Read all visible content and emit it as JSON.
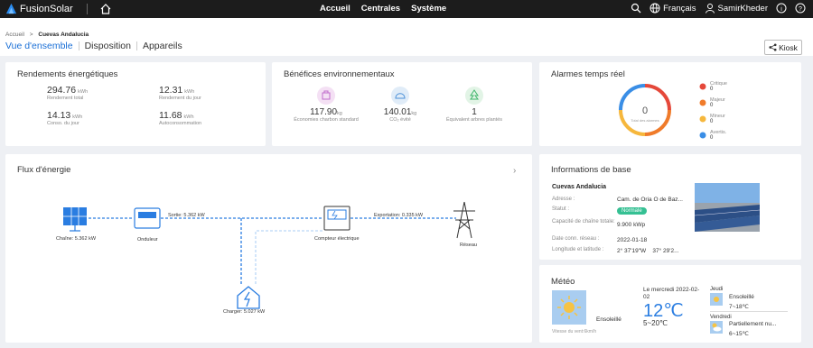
{
  "topbar": {
    "brand": "FusionSolar",
    "nav": [
      "Accueil",
      "Centrales",
      "Système"
    ],
    "language": "Français",
    "user": "SamirKheder",
    "info_icon": "i",
    "help_icon": "?"
  },
  "breadcrumb": {
    "root": "Accueil",
    "current": "Cuevas Andalucia",
    "separator": ">"
  },
  "tabs": [
    "Vue d'ensemble",
    "Disposition",
    "Appareils"
  ],
  "kiosk_label": "Kiosk",
  "yields": {
    "title": "Rendements énergétiques",
    "items": [
      {
        "value": "294.76",
        "unit": "kWh",
        "label": "Rendement total"
      },
      {
        "value": "12.31",
        "unit": "kWh",
        "label": "Rendement du jour"
      },
      {
        "value": "14.13",
        "unit": "kWh",
        "label": "Conso. du jour"
      },
      {
        "value": "11.68",
        "unit": "kWh",
        "label": "Autoconsommation"
      }
    ]
  },
  "env": {
    "title": "Bénéfices environnementaux",
    "items": [
      {
        "value": "117.90",
        "unit": "kg",
        "label": "Économies charbon standard",
        "color": "#f4e0f4"
      },
      {
        "value": "140.01",
        "unit": "kg",
        "label": "CO₂ évité",
        "color": "#e0ecf8"
      },
      {
        "value": "1",
        "unit": "",
        "label": "Équivalent arbres plantés",
        "color": "#e2f4e6"
      }
    ]
  },
  "alarms": {
    "title": "Alarmes temps réel",
    "total": "0",
    "total_label": "Total des alarmes",
    "items": [
      {
        "name": "Critique",
        "count": "0",
        "color": "#e5483a"
      },
      {
        "name": "Majeur",
        "count": "0",
        "color": "#f07b2a"
      },
      {
        "name": "Mineur",
        "count": "0",
        "color": "#f6b73c"
      },
      {
        "name": "Avertis.",
        "count": "0",
        "color": "#3a8ee6"
      }
    ]
  },
  "flow": {
    "title": "Flux d'énergie",
    "chaine": "Chaîne: 5.362 kW",
    "onduleur": "Onduleur",
    "sortie": "Sortie: 5.362 kW",
    "compteur": "Compteur électrique",
    "export": "Exportation: 0.335 kW",
    "reseau": "Réseau",
    "charger": "Charger: 5.027 kW"
  },
  "base": {
    "title": "Informations de base",
    "site": "Cuevas Andalucia",
    "rows": [
      {
        "label": "Adresse :",
        "value": "Cam. de Oria O de Baz..."
      },
      {
        "label": "Statut :",
        "value": "Normale"
      },
      {
        "label": "Capacité de chaîne totale:",
        "value": "9.900 kWp"
      },
      {
        "label": "Date conn. réseau :",
        "value": "2022-01-18"
      },
      {
        "label": "Longitude et latitude :",
        "value": "2° 37'19\"W    37° 29'2..."
      }
    ]
  },
  "weather": {
    "title": "Météo",
    "cond": "Ensoleillé",
    "wind": "Vitesse du vent:6km/h",
    "date": "Le mercredi  2022-02-02",
    "temp": "12℃",
    "range": "5~20℃",
    "forecast": [
      {
        "day": "Jeudi",
        "cond": "Ensoleillé",
        "range": "7~18℃"
      },
      {
        "day": "Vendredi",
        "cond": "Partiellement nu...",
        "range": "6~15℃"
      }
    ]
  }
}
